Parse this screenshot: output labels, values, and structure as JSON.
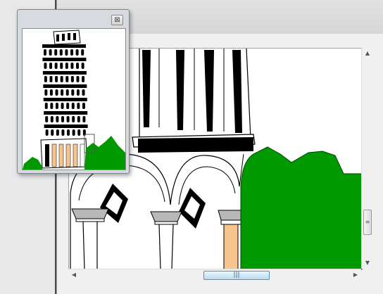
{
  "navigator": {
    "close_icon": "close-icon",
    "close_glyph": "⊠"
  },
  "scrollbars": {
    "vertical": {
      "up_glyph": "▲",
      "down_glyph": "▼",
      "grip_glyph": "≡"
    },
    "horizontal": {
      "left_glyph": "◀",
      "right_glyph": "▶",
      "grip_glyph": "|||"
    }
  },
  "colors": {
    "tree_green": "#009900",
    "column_peach": "#f8c48e",
    "capital_gray": "#b8b8b8",
    "thumb_blue": "#bcdaf0"
  }
}
